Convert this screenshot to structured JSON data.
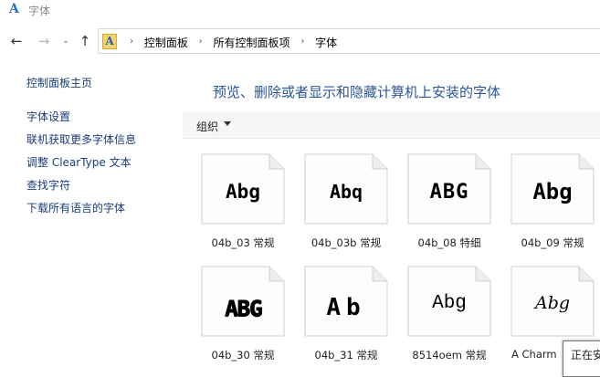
{
  "window": {
    "title": "字体"
  },
  "nav": {
    "back_icon": "←",
    "forward_icon": "→",
    "dropdown_icon": "⌄",
    "up_icon": "↑",
    "breadcrumbs": [
      "控制面板",
      "所有控制面板项",
      "字体"
    ],
    "crumb_separator": "›"
  },
  "sidebar": {
    "items": [
      {
        "label": "控制面板主页"
      },
      {
        "label": "字体设置"
      },
      {
        "label": "联机获取更多字体信息"
      },
      {
        "label": "调整 ClearType 文本"
      },
      {
        "label": "查找字符"
      },
      {
        "label": "下载所有语言的字体"
      }
    ]
  },
  "main": {
    "heading": "预览、删除或者显示和隐藏计算机上安装的字体",
    "organize_label": "组织"
  },
  "fonts": [
    {
      "preview": "Abg",
      "label": "04b_03 常规"
    },
    {
      "preview": "Abq",
      "label": "04b_03b 常规"
    },
    {
      "preview": "ABG",
      "label": "04b_08 特细"
    },
    {
      "preview": "Abg",
      "label": "04b_09 常规"
    },
    {
      "preview": "ABG",
      "label": "04b_30 常规"
    },
    {
      "preview": "Ab",
      "label": "04b_31 常规"
    },
    {
      "preview": "Abg",
      "label": "8514oem 常规"
    },
    {
      "preview": "Abg",
      "label": "A Charm"
    }
  ],
  "status": {
    "text": "正在安"
  },
  "colors": {
    "link": "#1a3d7a",
    "heading": "#2b5797",
    "folder_icon": "#f3d46b"
  }
}
